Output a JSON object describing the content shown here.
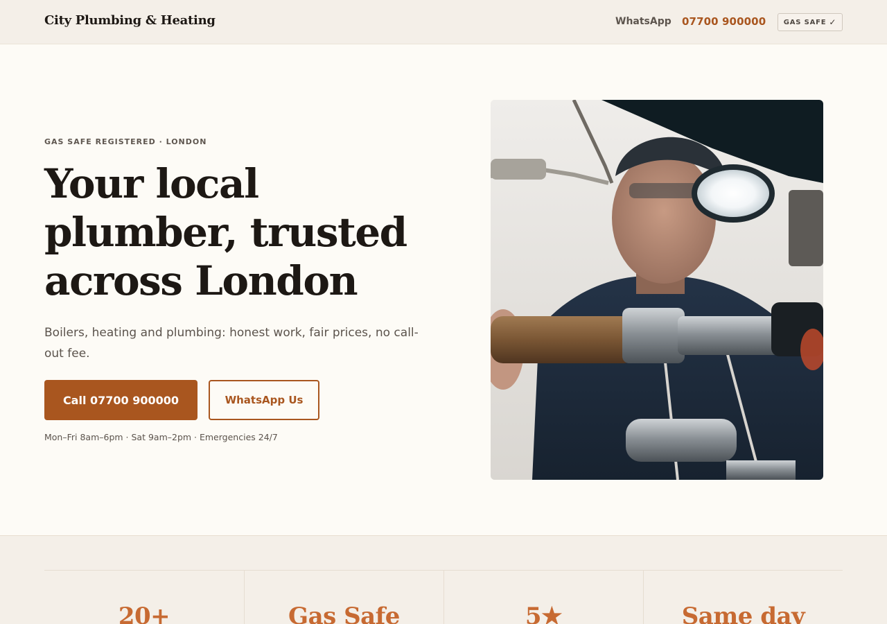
{
  "header": {
    "brand": "City Plumbing & Heating",
    "whatsapp_label": "WhatsApp",
    "phone": "07700 900000",
    "badge_label": "GAS SAFE",
    "badge_check": "✓"
  },
  "hero": {
    "eyebrow": "GAS SAFE REGISTERED · LONDON",
    "title": "Your local plumber, trusted across London",
    "subtitle": "Boilers, heating and plumbing: honest work, fair prices, no call-out fee.",
    "call_button": "Call 07700 900000",
    "whatsapp_button": "WhatsApp Us",
    "hours": "Mon–Fri 8am–6pm · Sat 9am–2pm · Emergencies 24/7"
  },
  "stats": [
    {
      "value": "20+"
    },
    {
      "value": "Gas Safe"
    },
    {
      "value": "5★"
    },
    {
      "value": "Same day"
    }
  ],
  "colors": {
    "accent": "#a9561f",
    "stat_accent": "#c76a32",
    "header_bg": "#f4efe8",
    "page_bg": "#fdfbf6",
    "text": "#1d1814"
  },
  "icons": {
    "badge": "check-icon"
  }
}
